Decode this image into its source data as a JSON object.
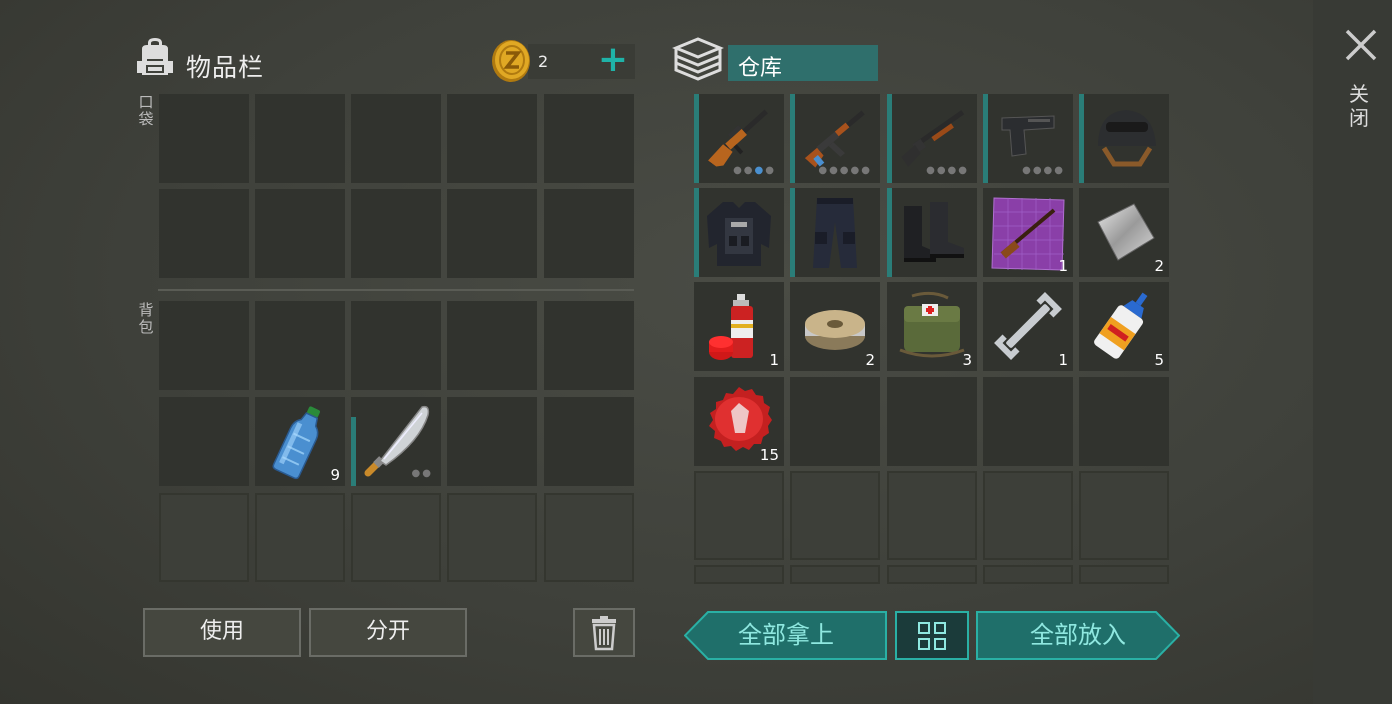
{
  "inventory": {
    "title": "物品栏",
    "pocket_label": "口袋",
    "backpack_label": "背包",
    "coins": "2",
    "add_symbol": "+",
    "slots": {
      "bottle_count": "9"
    }
  },
  "storage": {
    "title": "仓库",
    "counts": {
      "blueprint": "1",
      "metal_sheet": "2",
      "spray_paint": "1",
      "wire_spool": "2",
      "first_aid_bag": "3",
      "wrench": "1",
      "glue": "5",
      "bottle_cap": "15"
    },
    "items": [
      "svd-rifle-icon",
      "ak-rifle-icon",
      "shotgun-icon",
      "pistol-icon",
      "helmet-icon",
      "police-vest-icon",
      "police-pants-icon",
      "boots-icon",
      "blueprint-icon",
      "metal-sheet-icon",
      "spray-paint-icon",
      "wire-spool-icon",
      "first-aid-bag-icon",
      "wrench-icon",
      "glue-icon",
      "bottle-cap-icon"
    ]
  },
  "close_label": "关闭",
  "buttons": {
    "use": "使用",
    "split": "分开",
    "take_all": "全部拿上",
    "put_all": "全部放入"
  },
  "colors": {
    "accent": "#2ab0a5",
    "storage_tab": "#2f6f6c",
    "background": "#42443e"
  }
}
